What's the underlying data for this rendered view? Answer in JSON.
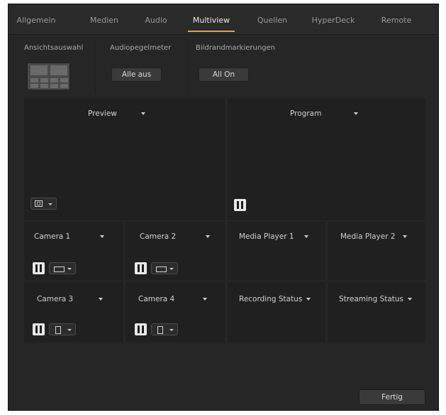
{
  "tabs": [
    "Allgemein",
    "Medien",
    "Audio",
    "Multiview",
    "Quellen",
    "HyperDeck",
    "Remote"
  ],
  "active_tab": "Multiview",
  "accent_color": "#f4a023",
  "layout_section": {
    "label": "Ansichtsauswahl"
  },
  "audio_section": {
    "label": "Audiopegelmeter",
    "button": "Alle aus"
  },
  "safe_section": {
    "label": "Bildrandmarkierungen",
    "button": "All On"
  },
  "big_windows": {
    "preview": "Preview",
    "program": "Program"
  },
  "small_windows": [
    "Camera 1",
    "Camera 2",
    "Media Player 1",
    "Media Player 2",
    "Camera 3",
    "Camera 4",
    "Recording Status",
    "Streaming Status"
  ],
  "icons": {
    "audio_meter": "audio-meter-icon",
    "safe_area_16_9": "safe-area-16-9-icon",
    "safe_area_4_3": "safe-area-4-3-icon",
    "safe_area_multi": "safe-area-multi-icon"
  },
  "done_button": "Fertig"
}
